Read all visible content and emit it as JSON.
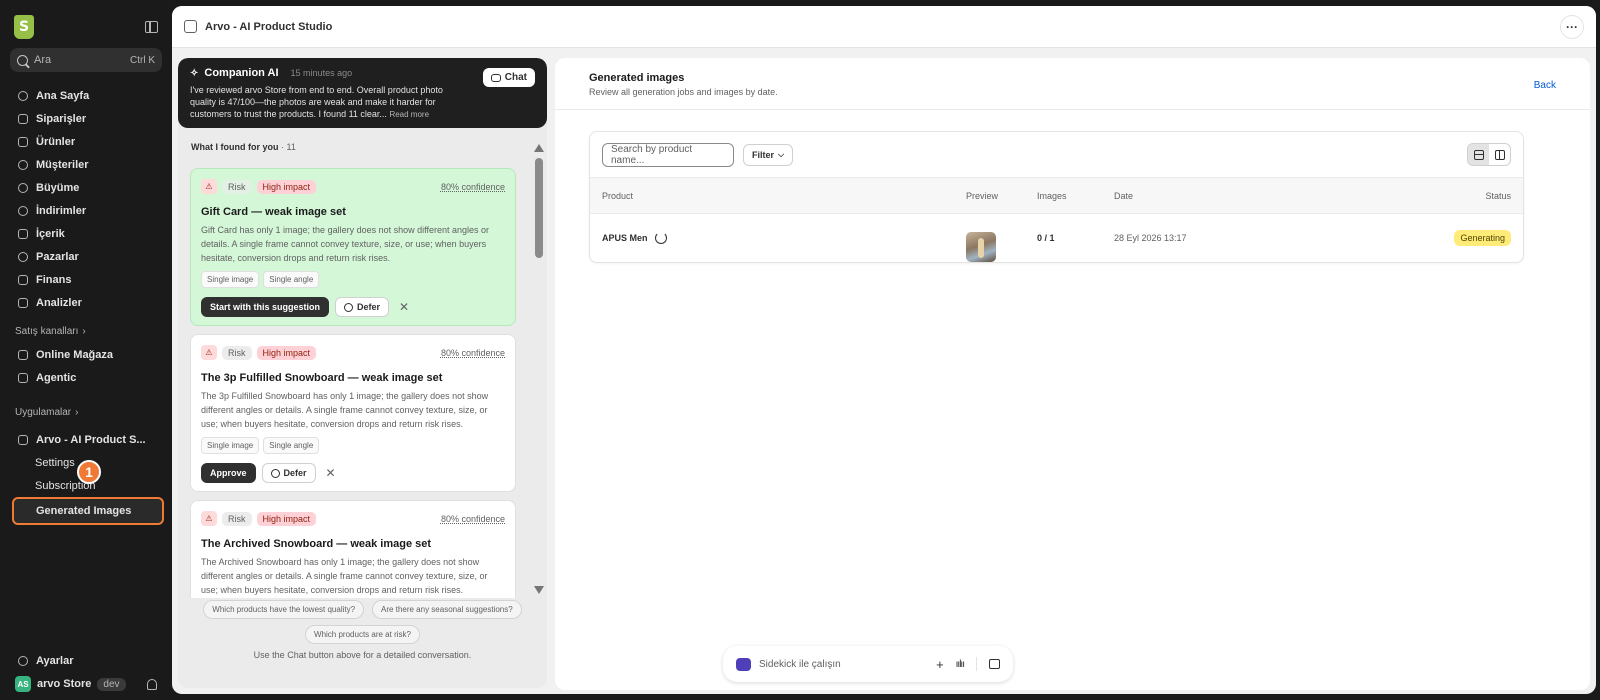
{
  "sidebar": {
    "search_placeholder": "Ara",
    "search_shortcut": "Ctrl K",
    "nav": [
      {
        "label": "Ana Sayfa",
        "icon": "home-icon"
      },
      {
        "label": "Siparişler",
        "icon": "orders-icon"
      },
      {
        "label": "Ürünler",
        "icon": "tag-icon"
      },
      {
        "label": "Müşteriler",
        "icon": "person-icon"
      },
      {
        "label": "Büyüme",
        "icon": "gauge-icon"
      },
      {
        "label": "İndirimler",
        "icon": "discount-icon"
      },
      {
        "label": "İçerik",
        "icon": "content-icon"
      },
      {
        "label": "Pazarlar",
        "icon": "globe-icon"
      },
      {
        "label": "Finans",
        "icon": "bank-icon"
      },
      {
        "label": "Analizler",
        "icon": "chart-icon"
      }
    ],
    "sales_channels_label": "Satış kanalları",
    "channels": [
      {
        "label": "Online Mağaza",
        "icon": "store-icon"
      },
      {
        "label": "Agentic",
        "icon": "agentic-icon"
      }
    ],
    "apps_label": "Uygulamalar",
    "app_name": "Arvo - AI Product S...",
    "app_sub": [
      "Settings",
      "Subscription",
      "Generated Images"
    ],
    "step_badge": "1",
    "settings_label": "Ayarlar",
    "store_avatar": "AS",
    "store_name": "arvo Store",
    "store_env": "dev"
  },
  "topbar": {
    "title": "Arvo - AI Product Studio",
    "more": "···"
  },
  "companion": {
    "title": "Companion AI",
    "time": "15 minutes ago",
    "summary": "I've reviewed arvo Store from end to end. Overall product photo quality is 47/100—the photos are weak and make it harder for customers to trust the products. I found 11 clear...",
    "read_more": "Read more",
    "chat_label": "Chat",
    "found_label": "What I found for you",
    "found_count": "· 11",
    "cards": [
      {
        "risk": "Risk",
        "impact": "High impact",
        "confidence": "80% confidence",
        "title": "Gift Card — weak image set",
        "desc": "Gift Card has only 1 image; the gallery does not show different angles or details. A single frame cannot convey texture, size, or use; when buyers hesitate, conversion drops and return risk rises.",
        "chips": [
          "Single image",
          "Single angle"
        ],
        "primary": "Start with this suggestion",
        "defer": "Defer",
        "dismiss": "✕"
      },
      {
        "risk": "Risk",
        "impact": "High impact",
        "confidence": "80% confidence",
        "title": "The 3p Fulfilled Snowboard — weak image set",
        "desc": "The 3p Fulfilled Snowboard has only 1 image; the gallery does not show different angles or details. A single frame cannot convey texture, size, or use; when buyers hesitate, conversion drops and return risk rises.",
        "chips": [
          "Single image",
          "Single angle"
        ],
        "primary": "Approve",
        "defer": "Defer",
        "dismiss": "✕"
      },
      {
        "risk": "Risk",
        "impact": "High impact",
        "confidence": "80% confidence",
        "title": "The Archived Snowboard — weak image set",
        "desc": "The Archived Snowboard has only 1 image; the gallery does not show different angles or details. A single frame cannot convey texture, size, or use; when buyers hesitate, conversion drops and return risk rises."
      }
    ],
    "suggestions": [
      "Which products have the lowest quality?",
      "Are there any seasonal suggestions?",
      "Which products are at risk?"
    ],
    "note": "Use the Chat button above for a detailed conversation."
  },
  "generated": {
    "title": "Generated images",
    "subtitle": "Review all generation jobs and images by date.",
    "back": "Back",
    "search_placeholder": "Search by product name...",
    "filter_label": "Filter",
    "columns": {
      "product": "Product",
      "preview": "Preview",
      "images": "Images",
      "date": "Date",
      "status": "Status"
    },
    "rows": [
      {
        "product": "APUS Men",
        "images": "0 / 1",
        "date": "28 Eyl 2026 13:17",
        "status": "Generating"
      }
    ]
  },
  "sidekick": {
    "placeholder": "Sidekick ile çalışın",
    "plus": "+",
    "voice": "ıılıı"
  },
  "colors": {
    "accent_orange": "#f07a35",
    "status_generating": "#ffeb78",
    "card_highlight": "#d4f7d8",
    "link_blue": "#005bd3"
  }
}
